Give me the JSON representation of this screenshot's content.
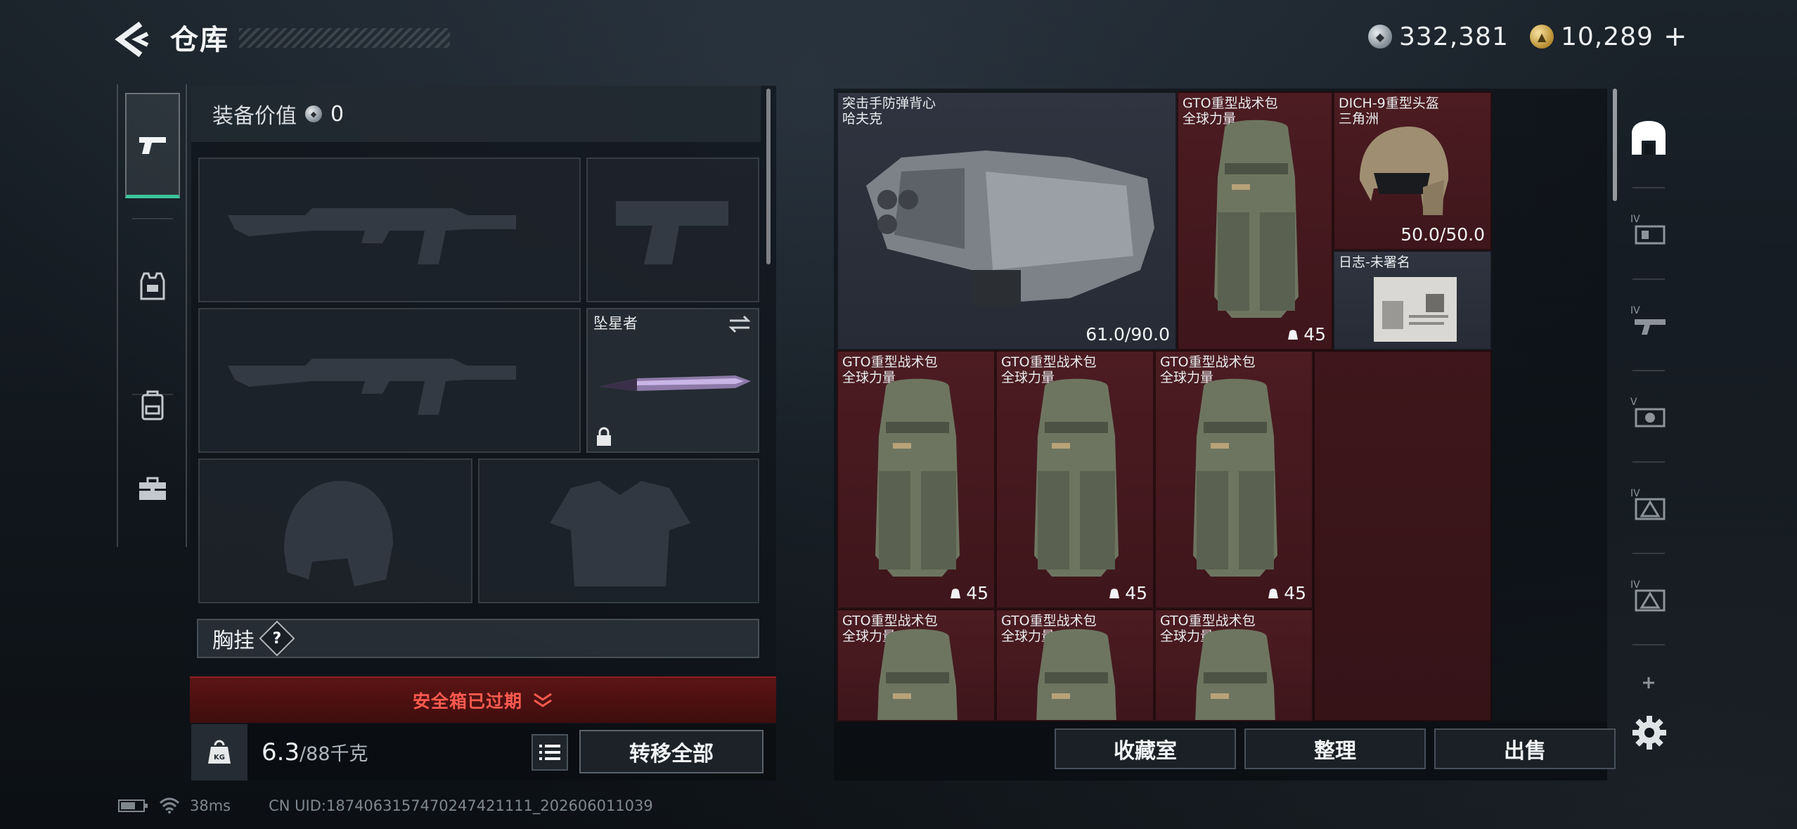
{
  "header": {
    "title": "仓库",
    "currency_silver": "332,381",
    "currency_gold": "10,289",
    "plus_label": "+"
  },
  "left_nav": {
    "items": [
      "weapons-tab",
      "armor-tab",
      "backpack-tab",
      "toolbox-tab"
    ]
  },
  "loadout": {
    "equip_value_label": "装备价值",
    "equip_value": "0",
    "melee_name": "坠星者",
    "chest_rig_label": "胸挂",
    "help_symbol": "?",
    "safe_box_status": "安全箱已过期",
    "weight_current": "6.3",
    "weight_max": "/88千克",
    "weight_icon_label": "KG",
    "transfer_all": "转移全部"
  },
  "stash": {
    "items": [
      {
        "name": "突击手防弹背心",
        "sub": "哈夫克",
        "stat": "61.0/90.0",
        "bg": "gray"
      },
      {
        "name": "GTO重型战术包",
        "sub": "全球力量",
        "stat": "45",
        "bg": "red"
      },
      {
        "name": "DICH-9重型头盔",
        "sub": "三角洲",
        "stat": "50.0/50.0",
        "bg": "red"
      },
      {
        "name": "日志-未署名",
        "sub": "",
        "stat": "",
        "bg": "gray"
      },
      {
        "name": "GTO重型战术包",
        "sub": "全球力量",
        "stat": "45",
        "bg": "red"
      },
      {
        "name": "GTO重型战术包",
        "sub": "全球力量",
        "stat": "45",
        "bg": "red"
      },
      {
        "name": "GTO重型战术包",
        "sub": "全球力量",
        "stat": "45",
        "bg": "red"
      },
      {
        "name": "GTO重型战术包",
        "sub": "全球力量",
        "stat": "",
        "bg": "red"
      },
      {
        "name": "GTO重型战术包",
        "sub": "全球力量",
        "stat": "",
        "bg": "red"
      },
      {
        "name": "GTO重型战术包",
        "sub": "全球力量",
        "stat": "",
        "bg": "red"
      }
    ],
    "buttons": {
      "collection": "收藏室",
      "sort": "整理",
      "sell": "出售"
    }
  },
  "right_nav": {
    "tier_labels": [
      "IV",
      "IV",
      "V",
      "IV",
      "IV"
    ]
  },
  "status": {
    "ping": "38ms",
    "uid": "CN UID:1874063157470247421111_202606011039"
  },
  "colors": {
    "accent_green": "#3ec59a",
    "expired_red": "#ff5a4f",
    "item_red_bg": "#4c1c22",
    "item_gray_bg": "#2f3440"
  }
}
